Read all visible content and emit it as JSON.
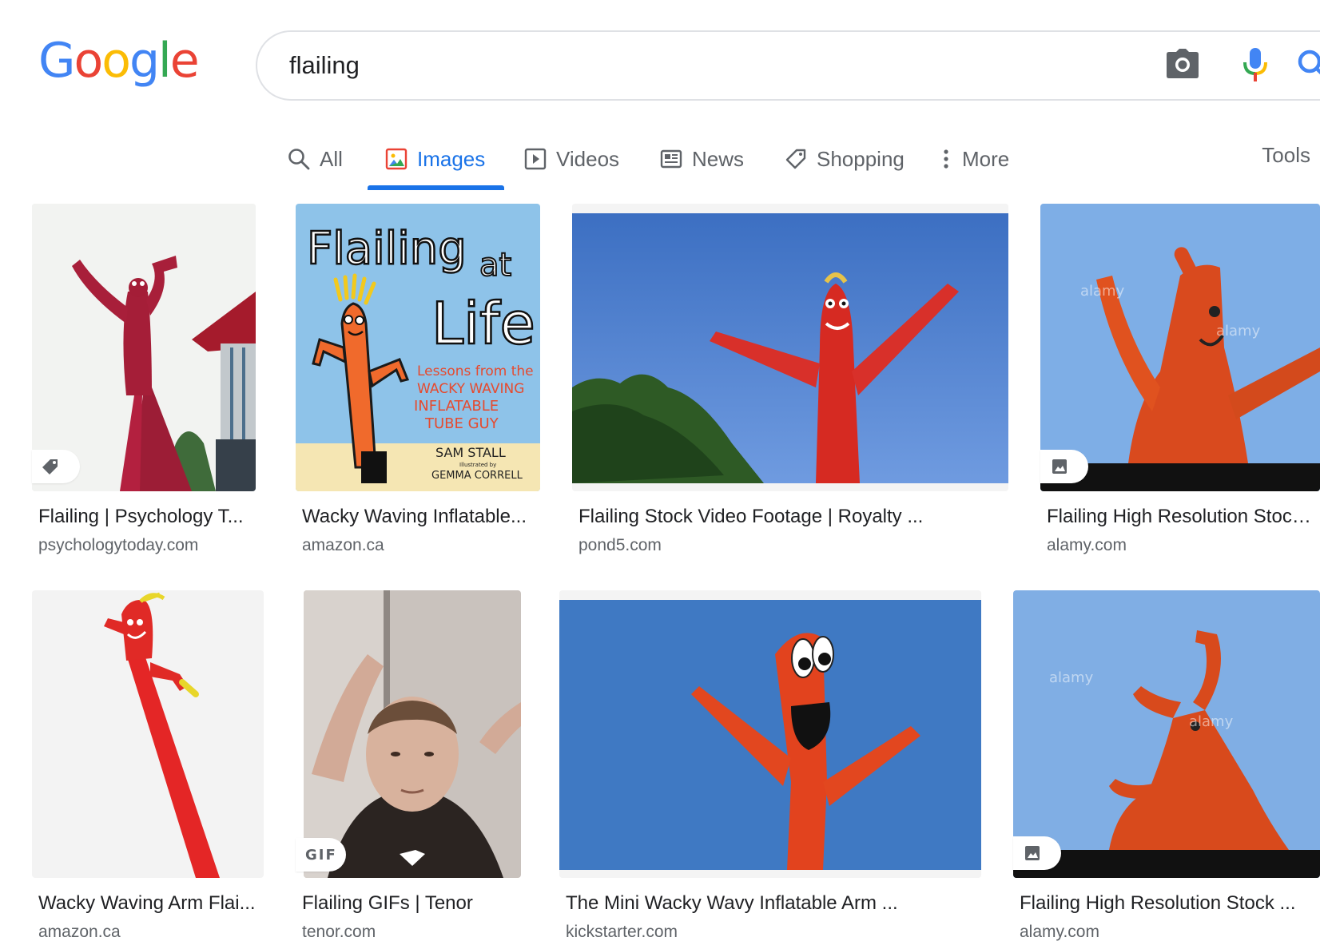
{
  "logo": {
    "letters": [
      "G",
      "o",
      "o",
      "g",
      "l",
      "e"
    ],
    "colors": [
      "#4285f4",
      "#ea4335",
      "#fbbc05",
      "#4285f4",
      "#34a853",
      "#ea4335"
    ]
  },
  "search": {
    "query": "flailing",
    "camera_icon": "camera-icon",
    "mic_icon": "mic-icon",
    "search_icon": "search-icon"
  },
  "tabs": [
    {
      "label": "All",
      "icon": "search-icon",
      "active": false
    },
    {
      "label": "Images",
      "icon": "image-icon",
      "active": true
    },
    {
      "label": "Videos",
      "icon": "play-icon",
      "active": false
    },
    {
      "label": "News",
      "icon": "news-icon",
      "active": false
    },
    {
      "label": "Shopping",
      "icon": "tag-icon",
      "active": false
    },
    {
      "label": "More",
      "icon": "more-vert-icon",
      "active": false
    }
  ],
  "tools_label": "Tools",
  "accent_color": "#1a73e8",
  "results": [
    {
      "title": "Flailing | Psychology T...",
      "source": "psychologytoday.com",
      "badge": "tag-icon"
    },
    {
      "title": "Wacky Waving Inflatable...",
      "source": "amazon.ca",
      "badge": "",
      "book": {
        "title_line1": "Flailing",
        "title_word2": "at",
        "title_line2": "Life",
        "sub1": "Lessons from the",
        "sub2": "WACKY WAVING",
        "sub3": "INFLATABLE",
        "sub4": "TUBE GUY",
        "author": "SAM STALL",
        "illus": "Illustrated by",
        "illustrator": "GEMMA CORRELL"
      }
    },
    {
      "title": "Flailing Stock Video Footage | Royalty ...",
      "source": "pond5.com",
      "badge": ""
    },
    {
      "title": "Flailing High Resolution Stock ...",
      "source": "alamy.com",
      "badge": "image-icon",
      "watermark": "alamy"
    },
    {
      "title": "Wacky Waving Arm Flai...",
      "source": "amazon.ca",
      "badge": ""
    },
    {
      "title": "Flailing GIFs | Tenor",
      "source": "tenor.com",
      "badge": "GIF"
    },
    {
      "title": "The Mini Wacky Wavy Inflatable Arm ...",
      "source": "kickstarter.com",
      "badge": ""
    },
    {
      "title": "Flailing High Resolution Stock ...",
      "source": "alamy.com",
      "badge": "image-icon",
      "watermark": "alamy"
    }
  ]
}
